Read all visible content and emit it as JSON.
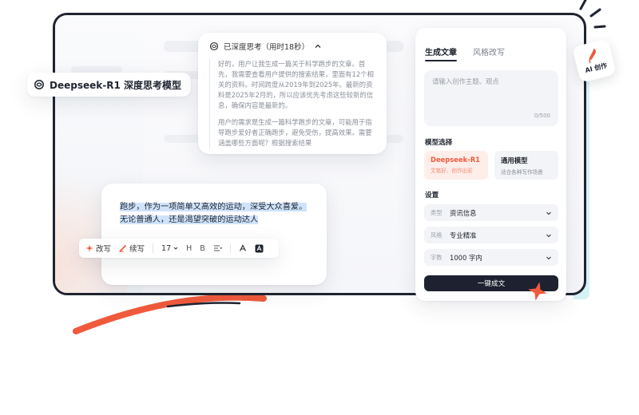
{
  "model_chip": {
    "label": "Deepseek-R1 深度思考模型",
    "icon": "deepseek-logo-icon"
  },
  "thinking": {
    "header": "已深度思考（用时18秒）",
    "toggle_icon": "chevron-up-icon",
    "paragraphs": [
      "好的，用户让我生成一篇关于科学跑步的文章。首先，我需要查看用户提供的搜索结果，里面有12个相关的资料。时间跨度从2019年到2025年。最新的资料是2025年2月的，所以应该优先考虑这些较新的信息，确保内容是最新的。",
      "用户的需求是生成一篇科学跑步的文章，可能用于指导跑步爱好者正确跑步，避免受伤，提高效果。需要涵盖哪些方面呢？根据搜索结果"
    ]
  },
  "editor": {
    "selected_text": "跑步，作为一项简单又高效的运动，深受大众喜爱。无论普通人，还是渴望突破的运动达人",
    "toolbar": {
      "rewrite_label": "改写",
      "continue_label": "续写",
      "font_size": "17",
      "heading_glyph": "H",
      "bold_glyph": "B"
    }
  },
  "panel": {
    "tabs": [
      {
        "label": "生成文章",
        "active": true
      },
      {
        "label": "风格改写",
        "active": false
      }
    ],
    "prompt_placeholder": "请输入创作主题、观点",
    "prompt_count": "0/500",
    "model_section_label": "模型选择",
    "models": [
      {
        "title": "Deepseek-R1",
        "desc": "文笔好、创作出彩",
        "selected": true
      },
      {
        "title": "通用模型",
        "desc": "适合各种写作场景",
        "selected": false
      }
    ],
    "settings_label": "设置",
    "settings": [
      {
        "key": "类型",
        "value": "资讯信息"
      },
      {
        "key": "风格",
        "value": "专业精准"
      },
      {
        "key": "字数",
        "value": "1000 字内"
      }
    ],
    "generate_label": "一键成文"
  },
  "ai_badge": {
    "label": "AI 创作"
  },
  "colors": {
    "accent": "#f05a3c",
    "accent_soft": "#fdeeea",
    "dark": "#1d2130",
    "window_dots": [
      "#f36b5e",
      "#f8c55a",
      "#5cc860"
    ],
    "teal_glow": "#cfeff4"
  }
}
